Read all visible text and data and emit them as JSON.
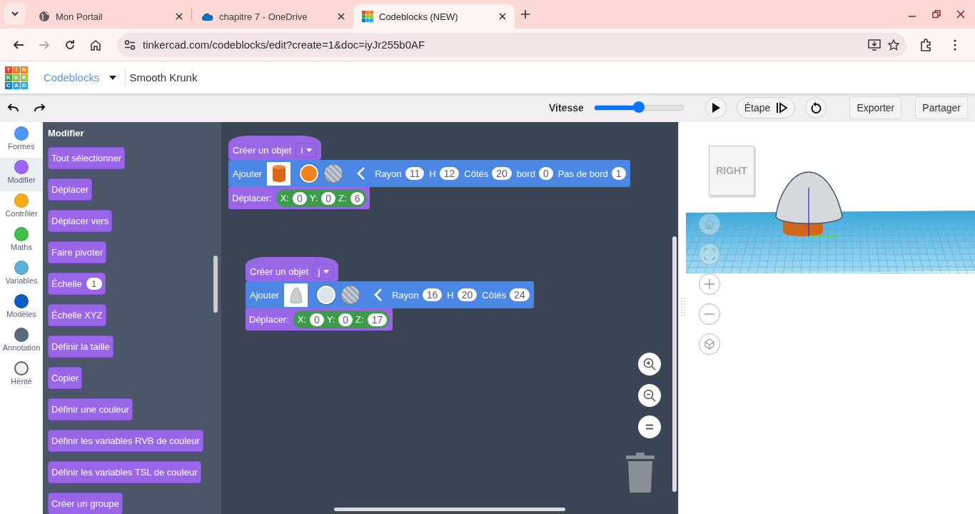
{
  "browser": {
    "tabs": [
      {
        "title": "Mon Portail",
        "selected": false
      },
      {
        "title": "chapitre 7 - OneDrive",
        "selected": false
      },
      {
        "title": "Codeblocks (NEW)",
        "selected": true
      }
    ],
    "url": "tinkercad.com/codeblocks/edit?create=1&doc=iyJr255b0AF"
  },
  "header": {
    "logo_letters": [
      "T",
      "I",
      "N",
      "K",
      "E",
      "R",
      "C",
      "A",
      "D"
    ],
    "product": "Codeblocks",
    "design_name": "Smooth Krunk"
  },
  "toolbar": {
    "speed_label": "Vitesse",
    "speed": {
      "level": 0.5
    },
    "step": "Étape",
    "export": "Exporter",
    "share": "Partager"
  },
  "categories": [
    {
      "label": "Formes",
      "color": "#4c97ff",
      "selected": false
    },
    {
      "label": "Modifier",
      "color": "#9966ff",
      "selected": true
    },
    {
      "label": "Contrôler",
      "color": "#ffab19",
      "selected": false
    },
    {
      "label": "Maths",
      "color": "#40bf4a",
      "selected": false
    },
    {
      "label": "Variables",
      "color": "#5cb1d6",
      "selected": false
    },
    {
      "label": "Modèles",
      "color": "#0b5cc4",
      "selected": false
    },
    {
      "label": "Annotation",
      "color": "#5a6a80",
      "selected": false
    },
    {
      "label": "Hérité",
      "color": "#eeeeee",
      "selected": false
    }
  ],
  "flyout": {
    "title": "Modifier",
    "blocks": [
      {
        "label": "Tout sélectionner"
      },
      {
        "label": "Déplacer"
      },
      {
        "label": "Déplacer vers"
      },
      {
        "label": "Faire pivoter"
      },
      {
        "label": "Échelle",
        "value": "1"
      },
      {
        "label": "Échelle XYZ"
      },
      {
        "label": "Définir la taille"
      },
      {
        "label": "Copier"
      },
      {
        "label": "Définir une couleur"
      },
      {
        "label": "Définir les variables RVB de couleur"
      },
      {
        "label": "Définir les variables TSL de couleur"
      },
      {
        "label": "Créer un groupe"
      }
    ]
  },
  "workspace": {
    "stacks": [
      {
        "create_label": "Créer un objet",
        "variable": "i",
        "add_label": "Ajouter",
        "kind": "cylinder",
        "color": "#f5821f",
        "params": [
          {
            "label": "Rayon",
            "value": "11"
          },
          {
            "label": "H",
            "value": "12"
          },
          {
            "label": "Côtés",
            "value": "20"
          },
          {
            "label": "bord",
            "value": "0"
          },
          {
            "label": "Pas de bord",
            "value": "1"
          }
        ],
        "move_label": "Déplacer:",
        "coords": [
          {
            "label": "X:",
            "value": "0"
          },
          {
            "label": "Y:",
            "value": "0"
          },
          {
            "label": "Z:",
            "value": "6"
          }
        ]
      },
      {
        "create_label": "Créer un objet",
        "variable": "j",
        "add_label": "Ajouter",
        "kind": "paraboloid",
        "color": "#dde3ea",
        "params": [
          {
            "label": "Rayon",
            "value": "16"
          },
          {
            "label": "H",
            "value": "20"
          },
          {
            "label": "Côtés",
            "value": "24"
          }
        ],
        "move_label": "Déplacer:",
        "coords": [
          {
            "label": "X:",
            "value": "0"
          },
          {
            "label": "Y:",
            "value": "0"
          },
          {
            "label": "Z:",
            "value": "17"
          }
        ]
      }
    ]
  },
  "viewer": {
    "view_cube": "RIGHT"
  }
}
